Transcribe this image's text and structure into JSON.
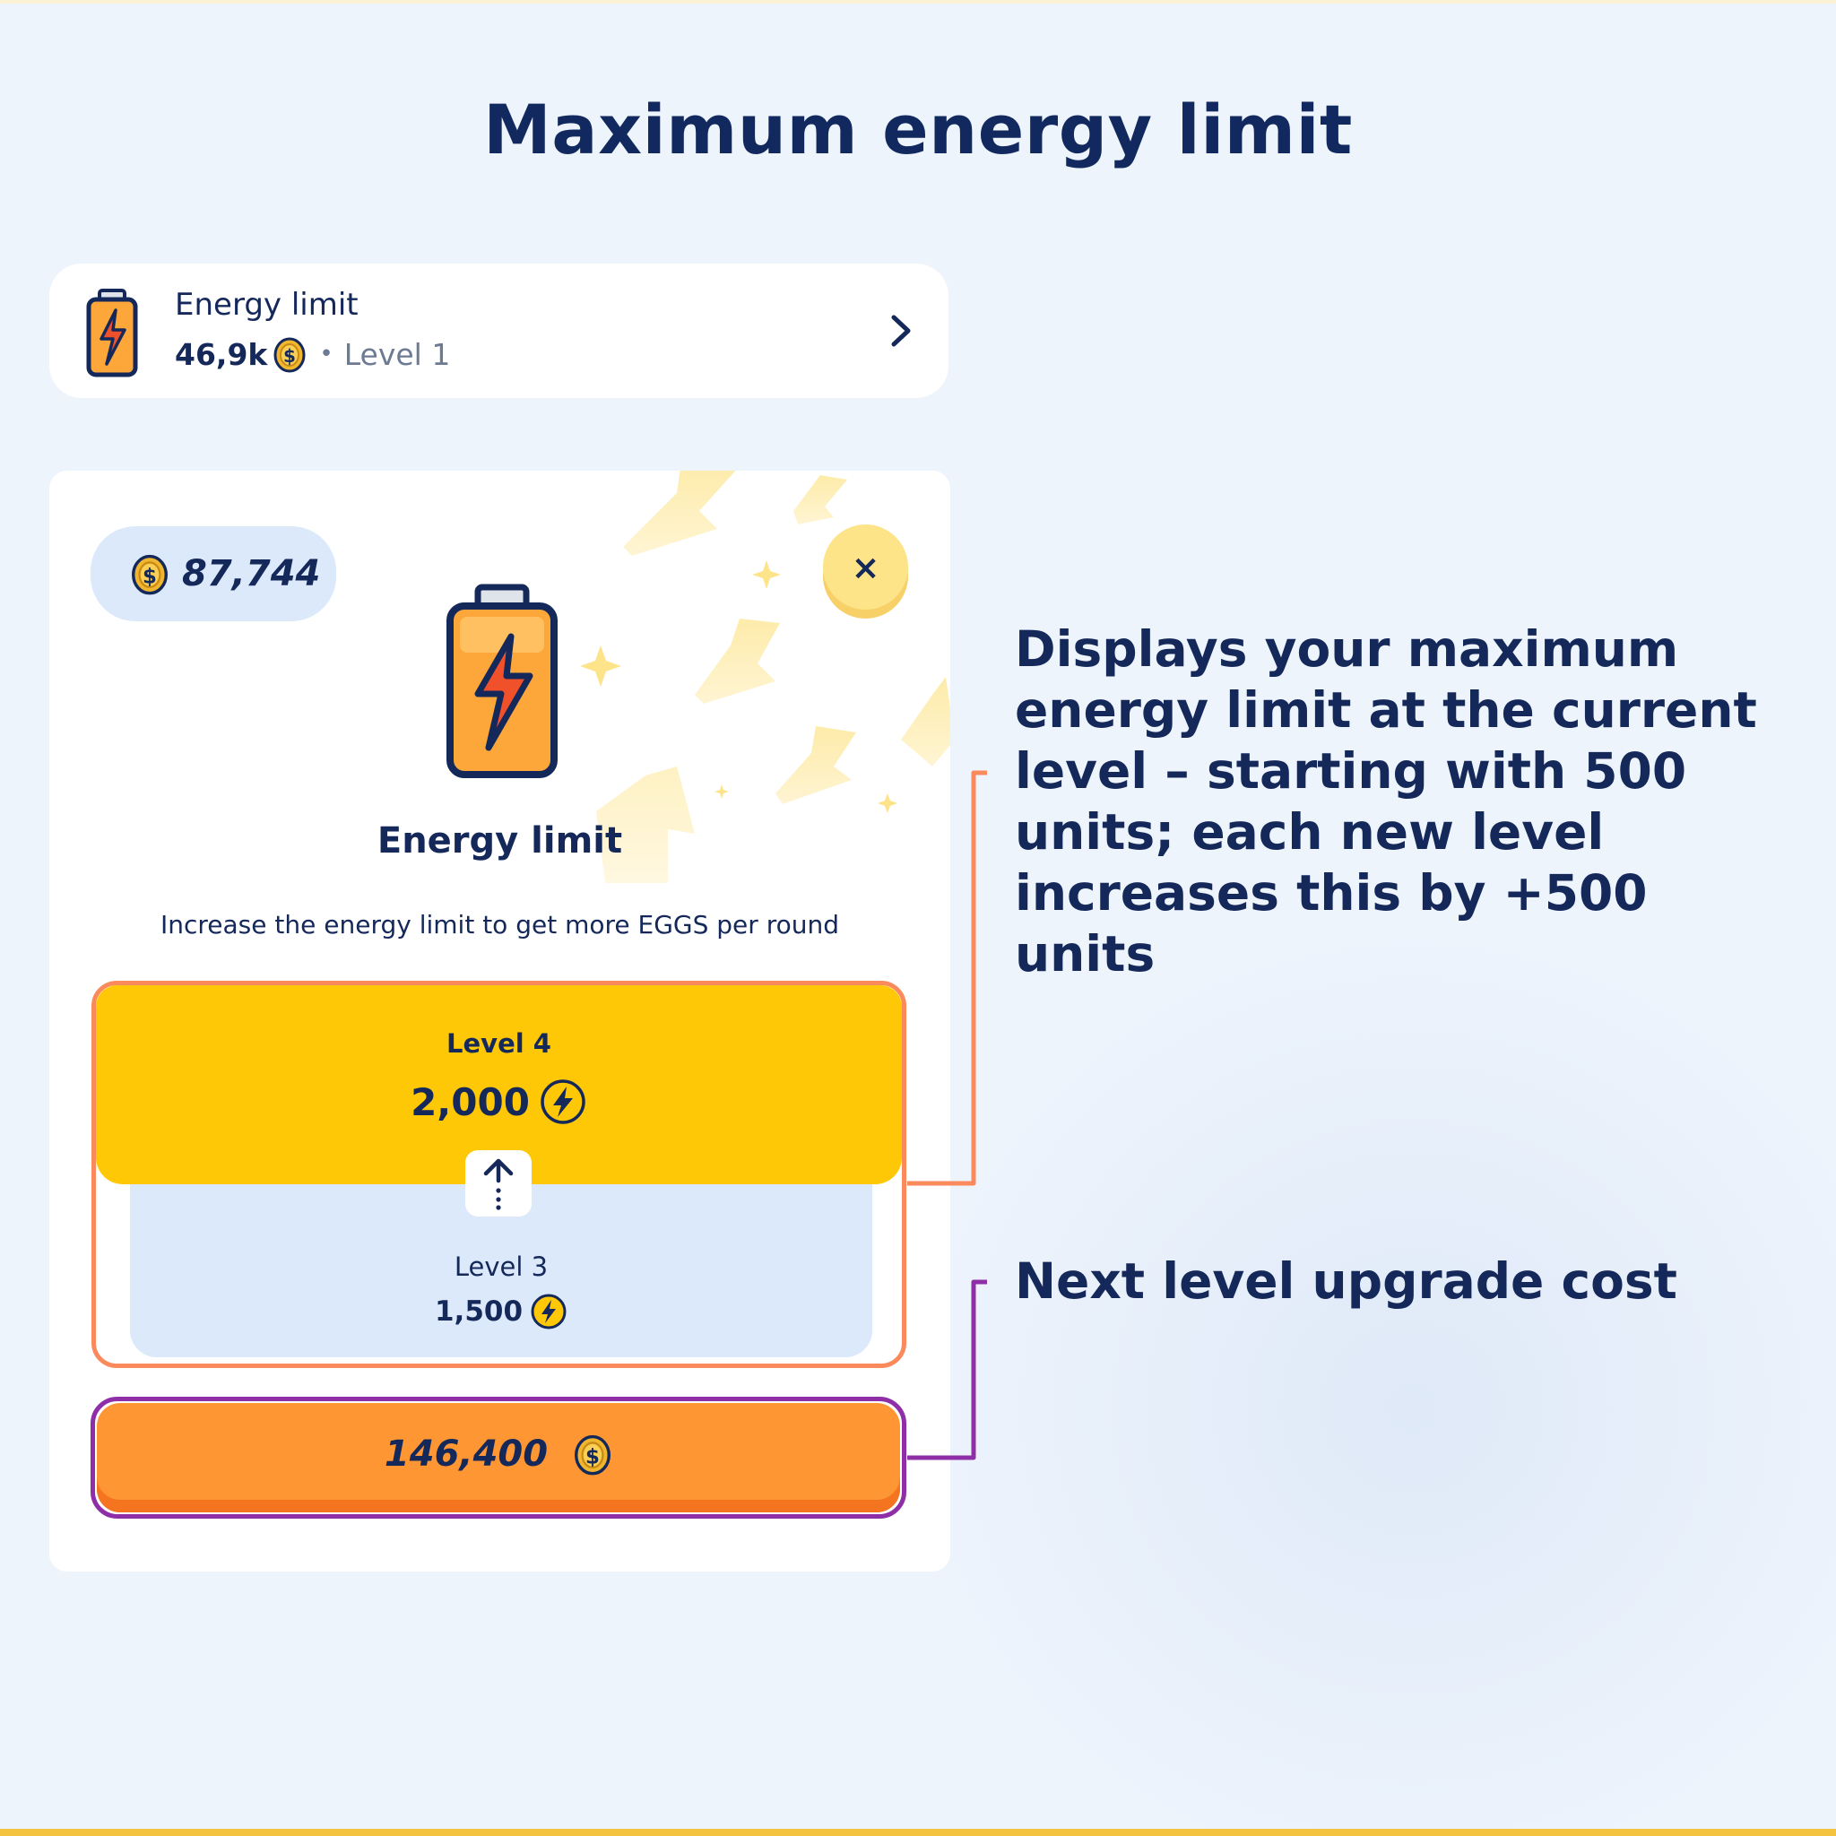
{
  "page": {
    "title": "Maximum energy limit"
  },
  "row_card": {
    "title": "Energy limit",
    "price": "46,9k",
    "separator": "•",
    "level": "Level 1",
    "icons": {
      "battery": "battery-icon",
      "coin": "coin-icon",
      "chevron": "chevron-right-icon"
    }
  },
  "modal": {
    "balance": "87,744",
    "close_label": "×",
    "title": "Energy limit",
    "description": "Increase the energy limit to get more EGGS per round",
    "next_level": {
      "label": "Level 4",
      "value": "2,000"
    },
    "current_level": {
      "label": "Level 3",
      "value": "1,500"
    },
    "upgrade_cost": "146,400"
  },
  "annotations": {
    "energy_limit_note": "Displays your maximum energy limit at the current level – starting with 500 units; each new level increases this by +500 units",
    "cost_note": "Next level upgrade cost"
  },
  "colors": {
    "background": "#eef4fc",
    "title_text": "#11295e",
    "next_level_bg": "#fec807",
    "current_level_bg": "#dbe9fb",
    "upgrade_button": "#fe9733",
    "levels_outline": "#fa8a5c",
    "cost_outline": "#8e2fa8"
  }
}
